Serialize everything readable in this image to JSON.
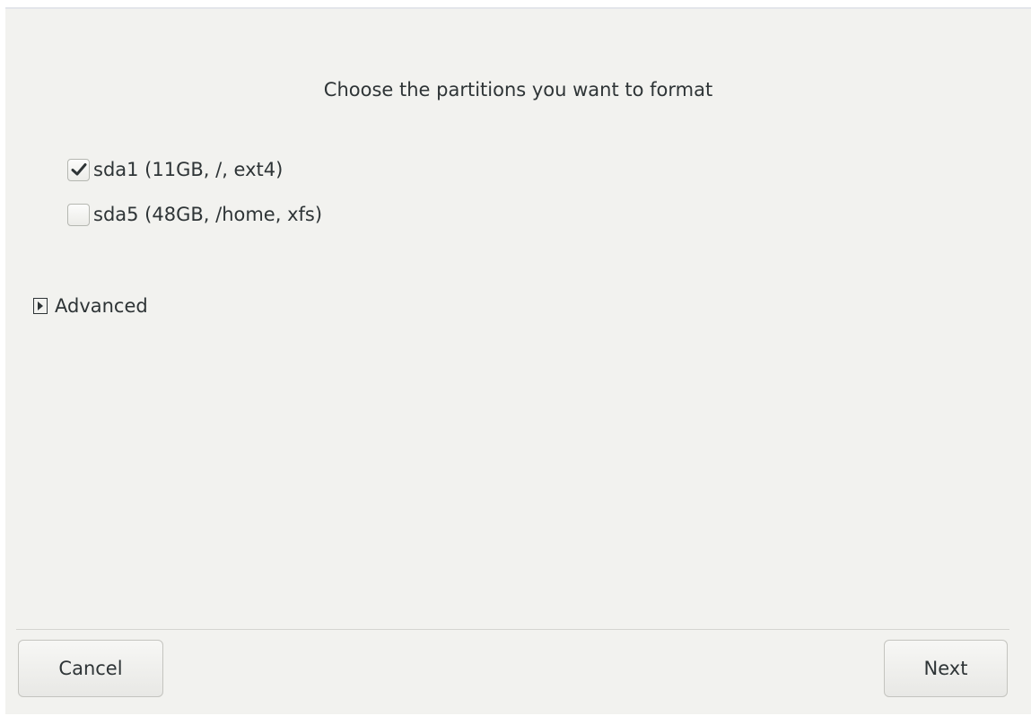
{
  "dialog": {
    "title": "Choose the partitions you want to format"
  },
  "partitions": [
    {
      "label": "sda1 (11GB, /, ext4)",
      "checked": true
    },
    {
      "label": "sda5 (48GB, /home, xfs)",
      "checked": false
    }
  ],
  "advanced": {
    "label": "Advanced",
    "expanded": false
  },
  "buttons": {
    "cancel_label": "Cancel",
    "next_label": "Next"
  }
}
